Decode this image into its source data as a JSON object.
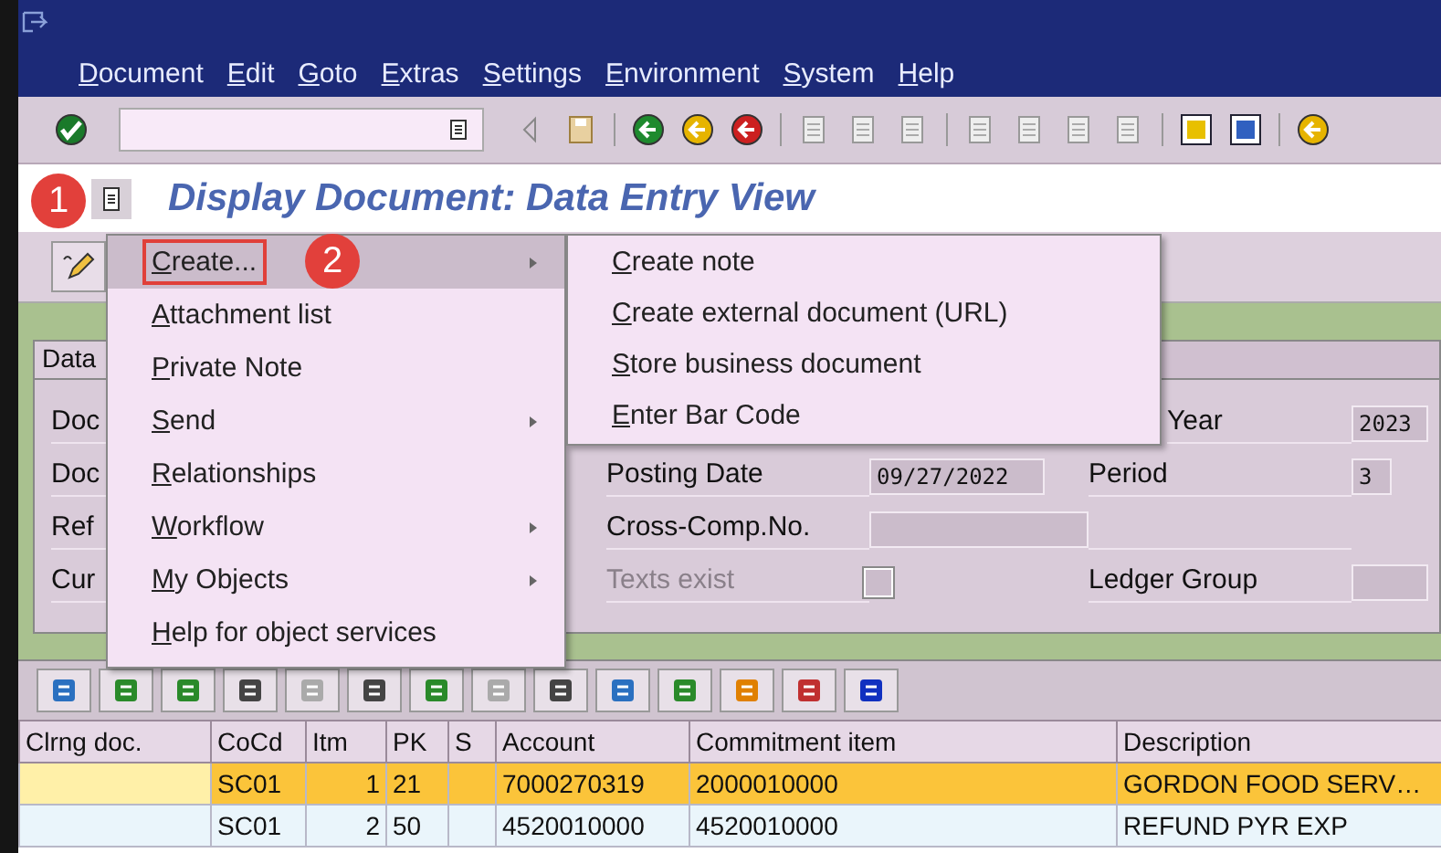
{
  "menu_bar": [
    "Document",
    "Edit",
    "Goto",
    "Extras",
    "Settings",
    "Environment",
    "System",
    "Help"
  ],
  "title": "Display Document: Data Entry View",
  "callouts": [
    "1",
    "2"
  ],
  "context_menu": {
    "items": [
      {
        "label": "Create...",
        "submenu": true,
        "selected": true,
        "outlined": true
      },
      {
        "label": "Attachment list",
        "submenu": false,
        "selected": false,
        "outlined": false
      },
      {
        "label": "Private Note",
        "submenu": false,
        "selected": false,
        "outlined": false
      },
      {
        "label": "Send",
        "submenu": true,
        "selected": false,
        "outlined": false
      },
      {
        "label": "Relationships",
        "submenu": false,
        "selected": false,
        "outlined": false
      },
      {
        "label": "Workflow",
        "submenu": true,
        "selected": false,
        "outlined": false
      },
      {
        "label": "My Objects",
        "submenu": true,
        "selected": false,
        "outlined": false
      },
      {
        "label": "Help for object services",
        "submenu": false,
        "selected": false,
        "outlined": false
      }
    ]
  },
  "submenu": {
    "items": [
      "Create note",
      "Create external document (URL)",
      "Store business document",
      "Enter Bar Code"
    ]
  },
  "form": {
    "tab": "Data",
    "rows": [
      {
        "left": "Doc",
        "label_2": "Year",
        "field_2": {
          "kind": "input",
          "value": "2023"
        }
      },
      {
        "left": "Doc",
        "label_1": "Posting Date",
        "field_1": {
          "kind": "input",
          "value": "09/27/2022"
        },
        "label_2": "Period",
        "field_2": {
          "kind": "input",
          "value": "3"
        }
      },
      {
        "left": "Ref",
        "label_1": "Cross-Comp.No.",
        "field_1": {
          "kind": "input"
        }
      },
      {
        "left": "Cur",
        "label_1": "Texts exist",
        "label_1_disabled": true,
        "field_1": {
          "kind": "checkbox",
          "checked": false
        },
        "label_2": "Ledger Group",
        "field_2": {
          "kind": "input"
        }
      }
    ]
  },
  "table": {
    "columns": [
      "Clrng doc.",
      "CoCd",
      "Itm",
      "PK",
      "S",
      "Account",
      "Commitment item",
      "Description"
    ],
    "rows": [
      {
        "selected": true,
        "cells": [
          "",
          "SC01",
          "1",
          "21",
          "",
          "7000270319",
          "2000010000",
          "GORDON FOOD SERV…"
        ]
      },
      {
        "selected": false,
        "cells": [
          "",
          "SC01",
          "2",
          "50",
          "",
          "4520010000",
          "4520010000",
          "REFUND PYR EXP"
        ]
      }
    ]
  }
}
